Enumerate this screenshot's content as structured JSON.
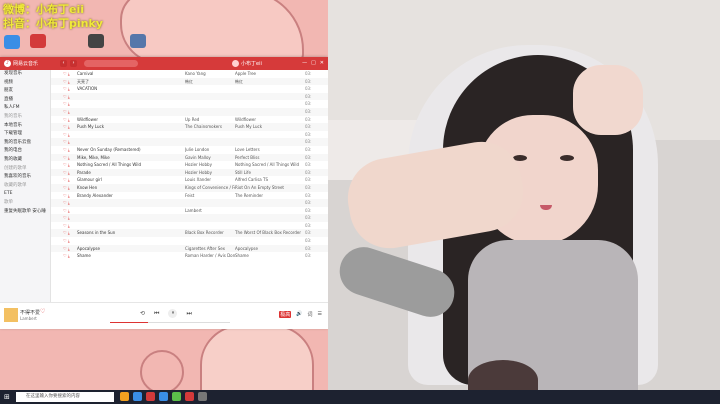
{
  "overlay": {
    "line1": "微博：小布丁eii",
    "line2": "抖音：小布丁pinky"
  },
  "desktop_icons": [
    {
      "label": "",
      "color": "#3a8ee6"
    },
    {
      "label": "",
      "color": "#d33a3a"
    },
    {
      "label": "",
      "color": "#444444"
    },
    {
      "label": "",
      "color": "#5577aa"
    }
  ],
  "app": {
    "name": "网易云音乐",
    "search_placeholder": "",
    "user_name": "小布丁eii",
    "nav_back": "‹",
    "nav_forward": "›",
    "window_buttons": [
      "—",
      "□",
      "✕"
    ]
  },
  "sidebar": {
    "items": [
      {
        "label": "发现音乐",
        "section": false
      },
      {
        "label": "视频",
        "section": false
      },
      {
        "label": "朋友",
        "section": false
      },
      {
        "label": "直播",
        "section": false
      },
      {
        "label": "私人FM",
        "section": false
      },
      {
        "label": "我的音乐",
        "section": true
      },
      {
        "label": "本地音乐",
        "section": false
      },
      {
        "label": "下载管理",
        "section": false
      },
      {
        "label": "我的音乐云盘",
        "section": false
      },
      {
        "label": "我的电台",
        "section": false
      },
      {
        "label": "我的收藏",
        "section": false
      },
      {
        "label": "创建的歌单",
        "section": true
      },
      {
        "label": "我喜欢的音乐",
        "section": false
      },
      {
        "label": "收藏的歌单",
        "section": true
      },
      {
        "label": "ETE",
        "section": false
      },
      {
        "label": "歌单",
        "section": true
      },
      {
        "label": "重复失眠歌单 安心睡",
        "section": false
      }
    ]
  },
  "songs": [
    {
      "idx": "",
      "title": "Carnival",
      "artist": "Kano Yang",
      "album": "Apple Tree",
      "dur": "03:"
    },
    {
      "idx": "",
      "title": "天亮了",
      "artist": "韩红",
      "album": "韩红",
      "dur": "03:"
    },
    {
      "idx": "",
      "title": "VACATION",
      "artist": "",
      "album": "",
      "dur": "03:"
    },
    {
      "idx": "",
      "title": "",
      "artist": "",
      "album": "",
      "dur": "03:"
    },
    {
      "idx": "",
      "title": "",
      "artist": "",
      "album": "",
      "dur": "03:"
    },
    {
      "idx": "",
      "title": "",
      "artist": "",
      "album": "",
      "dur": "03:"
    },
    {
      "idx": "",
      "title": "Wildflower",
      "artist": "Up Red",
      "album": "Wildflower",
      "dur": "03:"
    },
    {
      "idx": "",
      "title": "Push My Luck",
      "artist": "The Chainsmokers",
      "album": "Push My Luck",
      "dur": "03:"
    },
    {
      "idx": "",
      "title": "",
      "artist": "",
      "album": "",
      "dur": "03:"
    },
    {
      "idx": "",
      "title": "",
      "artist": "",
      "album": "",
      "dur": "03:"
    },
    {
      "idx": "",
      "title": "Never On Sunday (Remastered)",
      "artist": "Julie London",
      "album": "Love Letters",
      "dur": "03:"
    },
    {
      "idx": "",
      "title": "Mike, Mike, Mike",
      "artist": "Gavin Malloy",
      "album": "Perfect Bliss",
      "dur": "03:"
    },
    {
      "idx": "",
      "title": "Nothing Sacred / All Things Wild",
      "artist": "Hozier Hobby",
      "album": "Nothing Sacred / All Things Wild",
      "dur": "03:"
    },
    {
      "idx": "",
      "title": "Parade",
      "artist": "Hozier Hobby",
      "album": "Still Life",
      "dur": "03:"
    },
    {
      "idx": "",
      "title": "Glamour girl",
      "artist": "Louis Xander",
      "album": "Alfred Carlisa TS",
      "dur": "03:"
    },
    {
      "idx": "",
      "title": "Know Hen",
      "artist": "Kings of Convenience / Feist",
      "album": "Riot On An Empty Street",
      "dur": "03:"
    },
    {
      "idx": "",
      "title": "Brandy Alexander",
      "artist": "Feist",
      "album": "The Reminder",
      "dur": "03:"
    },
    {
      "idx": "",
      "title": "",
      "artist": "",
      "album": "",
      "dur": "03:"
    },
    {
      "idx": "",
      "title": "",
      "artist": "Lambert",
      "album": "",
      "dur": "03:"
    },
    {
      "idx": "",
      "title": "",
      "artist": "",
      "album": "",
      "dur": "03:"
    },
    {
      "idx": "",
      "title": "",
      "artist": "",
      "album": "",
      "dur": "03:"
    },
    {
      "idx": "",
      "title": "Seasons in the Sun",
      "artist": "Black Box Recorder",
      "album": "The Worst Of Black Box Recorder",
      "dur": "03:"
    },
    {
      "idx": "",
      "title": "",
      "artist": "",
      "album": "",
      "dur": "03:"
    },
    {
      "idx": "",
      "title": "Apocalypse",
      "artist": "Cigarettes After Sex",
      "album": "Apocalypse",
      "dur": "03:"
    },
    {
      "idx": "",
      "title": "Shame",
      "artist": "Roman Harder / Avis Dorner",
      "album": "Shame",
      "dur": "03:"
    }
  ],
  "now_playing": {
    "title": "不得不爱",
    "artist": "Lambert",
    "progress": 0.32,
    "time_current": "",
    "time_total": "",
    "controls": {
      "prev": "⏮",
      "play": "⏸",
      "next": "⏭",
      "mode": "⟲",
      "like": "♡"
    },
    "right": {
      "quality": "极高",
      "volume": "🔊",
      "lyrics": "词",
      "playlist": "☰"
    }
  },
  "taskbar": {
    "start": "⊞",
    "search_placeholder": "在这里输入你要搜索的内容",
    "time": "",
    "date": "",
    "icons": [
      "#f0a020",
      "#3a8ee6",
      "#d33a3a",
      "#3a8ee6",
      "#5bbf4a",
      "#d33a3a",
      "#777777"
    ]
  }
}
